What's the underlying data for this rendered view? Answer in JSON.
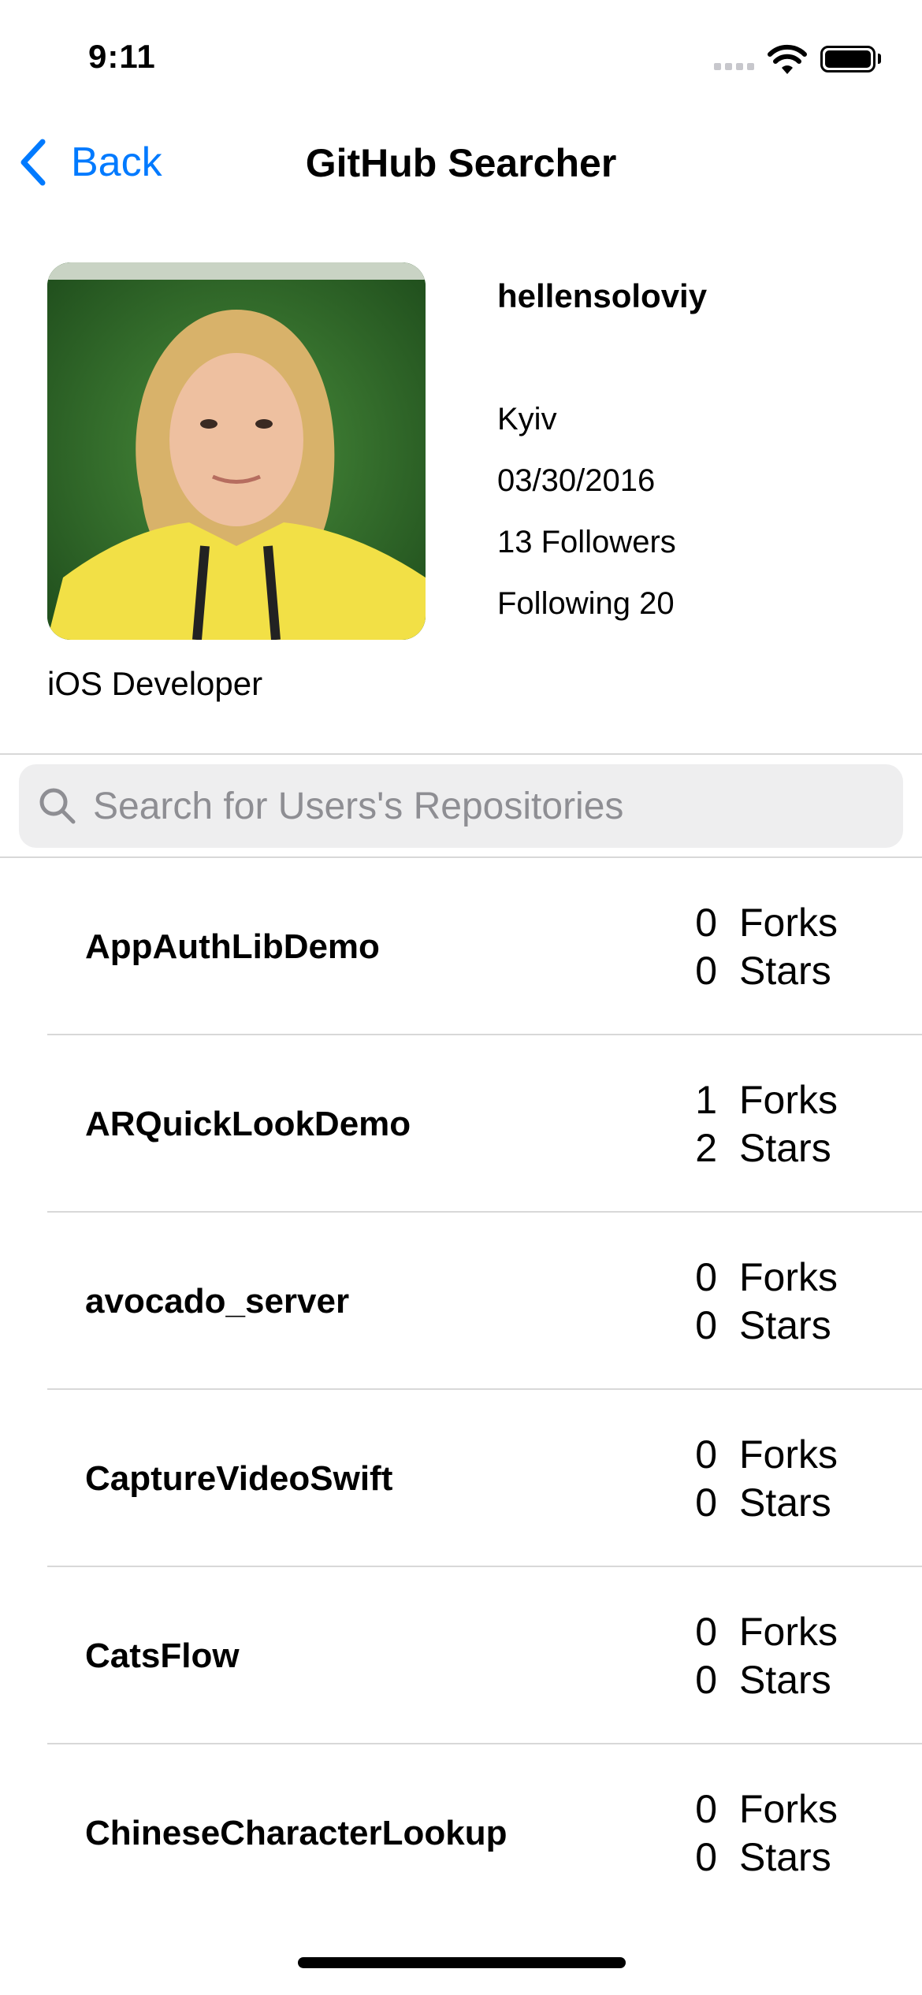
{
  "status_bar": {
    "time": "9:11"
  },
  "nav": {
    "back_label": "Back",
    "title": "GitHub Searcher"
  },
  "profile": {
    "username": "hellensoloviy",
    "location": "Kyiv",
    "join_date": "03/30/2016",
    "followers": "13 Followers",
    "following": "Following 20",
    "bio": "iOS Developer"
  },
  "search": {
    "placeholder": "Search for Users's Repositories",
    "value": ""
  },
  "repos": [
    {
      "name": "AppAuthLibDemo",
      "forks": "0",
      "stars": "0"
    },
    {
      "name": "ARQuickLookDemo",
      "forks": "1",
      "stars": "2"
    },
    {
      "name": "avocado_server",
      "forks": "0",
      "stars": "0"
    },
    {
      "name": "CaptureVideoSwift",
      "forks": "0",
      "stars": "0"
    },
    {
      "name": "CatsFlow",
      "forks": "0",
      "stars": "0"
    },
    {
      "name": "ChineseCharacterLookup",
      "forks": "0",
      "stars": "0"
    }
  ],
  "labels": {
    "forks": "Forks",
    "stars": "Stars"
  },
  "colors": {
    "accent": "#007aff",
    "placeholder": "#8e8e93"
  }
}
